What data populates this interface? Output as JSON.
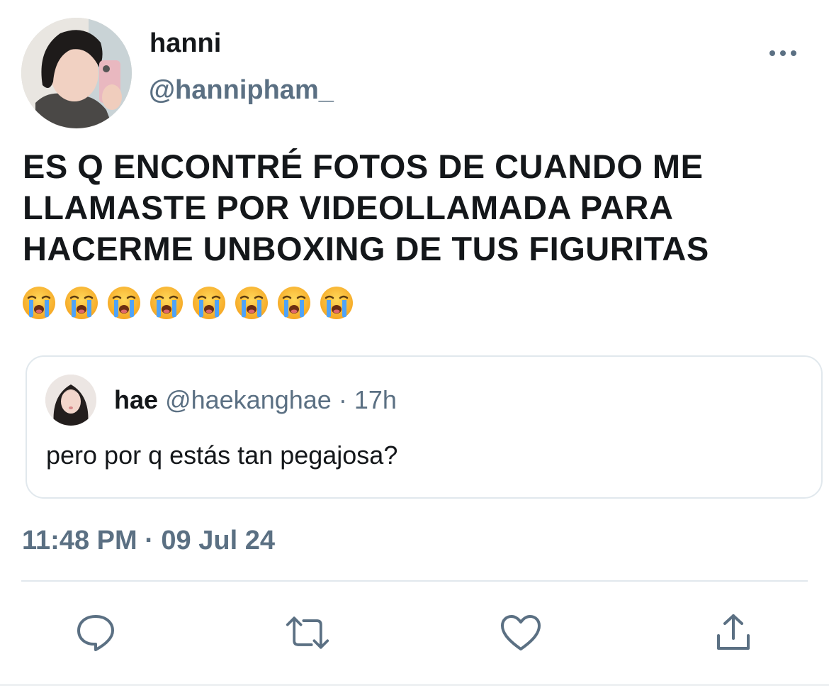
{
  "tweet": {
    "display_name": "hanni",
    "handle": "@hannipham_",
    "text": "ES Q ENCONTRÉ FOTOS DE CUANDO ME LLAMASTE POR VIDEOLLAMADA PARA HACERME UNBOXING DE TUS FIGURITAS",
    "emojis": [
      "😭",
      "😭",
      "😭",
      "😭",
      "😭",
      "😭",
      "😭",
      "😭"
    ],
    "timestamp": "11:48 PM · 09 Jul 24"
  },
  "quoted_tweet": {
    "display_name": "hae",
    "handle": "@haekanghae",
    "separator": "·",
    "age": "17h",
    "text": "pero por q estás tan pegajosa?"
  },
  "actions": {
    "icons": [
      "reply-icon",
      "retweet-icon",
      "like-icon",
      "share-icon"
    ],
    "icon_color": "#5b7083"
  },
  "colors": {
    "text_primary": "#14171a",
    "text_secondary": "#5b7083",
    "border": "#e1e8ed"
  }
}
